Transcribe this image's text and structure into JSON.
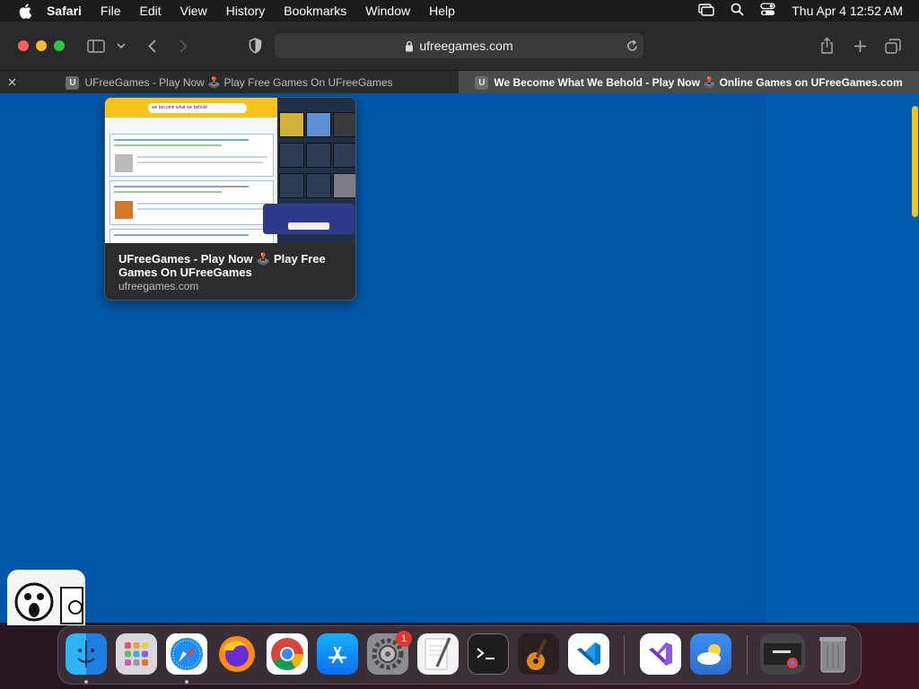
{
  "menubar": {
    "app_name": "Safari",
    "items": [
      "File",
      "Edit",
      "View",
      "History",
      "Bookmarks",
      "Window",
      "Help"
    ],
    "clock": "Thu Apr 4  12:52 AM"
  },
  "toolbar": {
    "url": "ufreegames.com"
  },
  "tabs": [
    {
      "favicon_letter": "U",
      "title": "UFreeGames - Play Now 🕹️ Play Free Games On UFreeGames",
      "active": false
    },
    {
      "favicon_letter": "U",
      "title": "We Become What We Behold - Play Now 🕹️ Online Games on UFreeGames.com",
      "active": true
    }
  ],
  "preview": {
    "title": "UFreeGames - Play Now 🕹️ Play Free Games On UFreeGames",
    "domain": "ufreegames.com",
    "thumb_search": "we become what we behold"
  },
  "dock": {
    "apps": [
      "Finder",
      "Launchpad",
      "Safari",
      "Firefox",
      "Google Chrome",
      "App Store",
      "System Settings",
      "TextEdit",
      "Terminal",
      "GarageBand",
      "Visual Studio Code",
      "Visual Studio",
      "Weather",
      "Google Chrome Window",
      "Trash"
    ],
    "system_settings_badge": "1"
  },
  "colors": {
    "page_background": "#0057a8",
    "accent_yellow": "#f2c220"
  }
}
